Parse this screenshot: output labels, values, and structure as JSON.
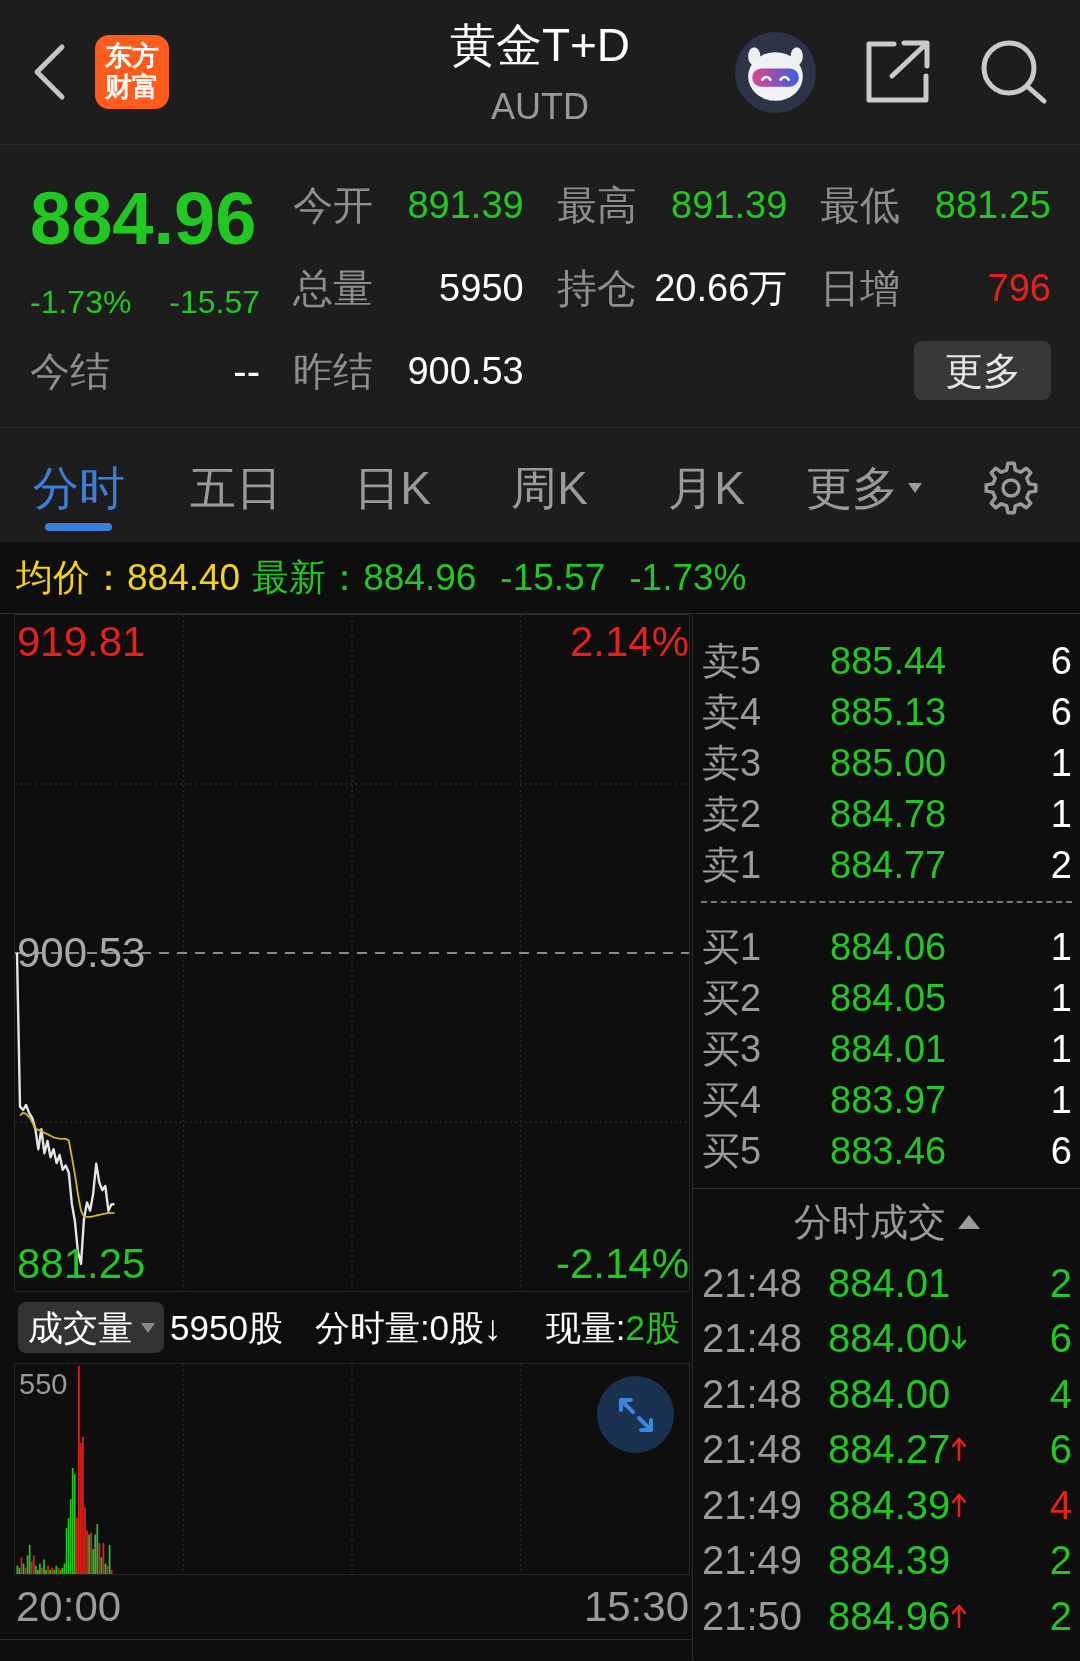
{
  "header": {
    "logo": {
      "lines": [
        "东方",
        "财富"
      ]
    },
    "title": "黄金T+D",
    "subtitle": "AUTD"
  },
  "quote": {
    "price": "884.96",
    "change_percent": "-1.73%",
    "change": "-15.57",
    "settle": {
      "label": "今结",
      "value": "--"
    },
    "stats": [
      {
        "label": "今开",
        "value": "891.39",
        "color": "#22c822"
      },
      {
        "label": "最高",
        "value": "891.39",
        "color": "#22c822"
      },
      {
        "label": "最低",
        "value": "881.25",
        "color": "#22c822"
      },
      {
        "label": "总量",
        "value": "5950",
        "color": "#ffffff"
      },
      {
        "label": "持仓",
        "value": "20.66万",
        "color": "#ffffff"
      },
      {
        "label": "日增",
        "value": "796",
        "color": "#e3221c"
      },
      {
        "label": "昨结",
        "value": "900.53",
        "color": "#ffffff"
      }
    ],
    "more_button": "更多"
  },
  "tabs": [
    {
      "label": "分时",
      "kind": "tab",
      "selected": true
    },
    {
      "label": "五日",
      "kind": "tab",
      "selected": false
    },
    {
      "label": "日K",
      "kind": "tab",
      "selected": false
    },
    {
      "label": "周K",
      "kind": "tab",
      "selected": false
    },
    {
      "label": "月K",
      "kind": "tab",
      "selected": false
    },
    {
      "label": "更多",
      "kind": "dropdown",
      "selected": false
    }
  ],
  "summary_line": {
    "average_label": "均价：",
    "average": "884.40",
    "latest_label": "最新：",
    "latest": "884.96",
    "change": "-15.57",
    "change_percent": "-1.73%"
  },
  "price_chart": {
    "chart_data": {
      "type": "line",
      "categories": [
        null,
        null,
        null,
        null,
        null,
        null,
        null,
        null,
        null,
        null,
        null,
        null,
        null,
        null,
        null,
        null,
        null,
        null,
        null,
        null,
        null,
        null,
        null,
        null,
        null,
        null,
        null,
        null,
        null,
        null,
        null,
        null,
        null,
        null,
        null,
        null,
        null,
        null,
        null,
        null,
        null,
        null,
        null,
        null,
        null,
        null,
        null,
        null,
        null,
        null,
        null,
        null,
        null,
        null,
        null,
        null,
        null,
        null,
        null,
        null,
        null,
        null,
        null,
        null,
        null,
        null,
        null,
        null,
        null,
        null,
        null,
        null,
        null,
        null,
        null,
        null,
        null,
        null,
        null,
        null,
        null,
        null,
        null,
        null,
        null,
        null,
        null,
        null,
        null,
        null,
        null,
        null,
        null,
        null,
        null,
        null,
        null,
        null,
        null,
        null,
        null,
        null,
        null,
        null,
        null,
        null,
        null,
        null,
        null,
        null,
        null,
        null,
        null,
        null,
        null,
        null,
        null,
        null,
        null,
        null,
        null,
        null,
        null,
        null,
        null,
        null,
        null,
        null,
        null,
        null,
        null,
        null,
        null,
        null,
        null,
        null,
        null,
        null,
        null,
        null,
        null,
        null,
        null,
        null,
        null,
        null,
        null,
        null,
        null,
        null,
        null,
        null,
        null,
        null,
        null,
        null,
        null,
        null,
        null,
        null,
        null,
        null,
        null,
        null,
        null,
        null,
        null,
        null,
        null,
        null,
        null,
        null,
        null,
        null,
        null,
        null,
        null,
        null,
        null,
        null,
        null,
        null,
        null,
        null,
        null,
        null,
        null,
        null,
        null,
        null,
        null,
        null,
        null,
        null,
        null,
        null,
        null,
        null,
        null,
        null,
        null,
        null,
        null,
        null,
        null,
        null,
        null,
        null,
        null,
        null,
        null,
        null,
        null,
        null,
        null,
        null,
        null,
        null,
        null,
        null,
        null
      ],
      "series": [
        {
          "color": "#e6e6e6",
          "values": [
            900.53,
            891.0,
            890.8,
            891.1,
            890.6,
            890.3,
            889.63,
            888.36,
            889.6,
            888.11,
            888.87,
            887.86,
            888.36,
            887.5,
            888.0,
            887.09,
            887.35,
            886.9,
            885.0,
            883.9,
            882.01,
            881.25,
            884.05,
            885.06,
            884.55,
            885.57,
            887.47,
            886.33,
            885.82,
            886.08,
            884.55,
            884.93,
            884.96,
            null,
            null,
            null,
            null,
            null,
            null,
            null,
            null,
            null,
            null,
            null,
            null,
            null,
            null,
            null,
            null,
            null,
            null,
            null,
            null,
            null,
            null,
            null,
            null,
            null,
            null,
            null,
            null,
            null,
            null,
            null,
            null,
            null,
            null,
            null,
            null,
            null,
            null,
            null,
            null,
            null,
            null,
            null,
            null,
            null,
            null,
            null,
            null,
            null,
            null,
            null,
            null,
            null,
            null,
            null,
            null,
            null,
            null,
            null,
            null,
            null,
            null,
            null,
            null,
            null,
            null,
            null,
            null,
            null,
            null,
            null,
            null,
            null,
            null,
            null,
            null,
            null,
            null,
            null,
            null,
            null,
            null,
            null,
            null,
            null,
            null,
            null,
            null,
            null,
            null,
            null,
            null,
            null,
            null,
            null,
            null,
            null,
            null,
            null,
            null,
            null,
            null,
            null,
            null,
            null,
            null,
            null,
            null,
            null,
            null,
            null,
            null,
            null,
            null,
            null,
            null,
            null,
            null,
            null,
            null,
            null,
            null,
            null,
            null,
            null,
            null,
            null,
            null,
            null,
            null,
            null,
            null,
            null,
            null,
            null,
            null,
            null,
            null,
            null,
            null,
            null,
            null,
            null,
            null,
            null,
            null,
            null,
            null,
            null,
            null,
            null,
            null,
            null,
            null,
            null,
            null,
            null,
            null,
            null,
            null,
            null,
            null,
            null,
            null,
            null,
            null,
            null,
            null,
            null,
            null,
            null,
            null,
            null,
            null,
            null,
            null,
            null,
            null,
            null,
            null,
            null,
            null,
            null,
            null,
            null,
            null,
            null,
            null
          ]
        },
        {
          "color": "#d6b62c",
          "values": [
            null,
            890.45,
            890.62,
            890.55,
            890.35,
            890.05,
            889.63,
            889.56,
            889.48,
            889.38,
            889.3,
            889.2,
            889.1,
            889.05,
            889.02,
            889.0,
            889.0,
            888.9,
            887.9,
            886.8,
            885.57,
            884.55,
            884.17,
            884.17,
            884.17,
            884.2,
            884.25,
            884.28,
            884.33,
            884.37,
            884.43,
            884.41,
            884.4,
            null,
            null,
            null,
            null,
            null,
            null,
            null,
            null,
            null,
            null,
            null,
            null,
            null,
            null,
            null,
            null,
            null,
            null,
            null,
            null,
            null,
            null,
            null,
            null,
            null,
            null,
            null,
            null,
            null,
            null,
            null,
            null,
            null,
            null,
            null,
            null,
            null,
            null,
            null,
            null,
            null,
            null,
            null,
            null,
            null,
            null,
            null,
            null,
            null,
            null,
            null,
            null,
            null,
            null,
            null,
            null,
            null,
            null,
            null,
            null,
            null,
            null,
            null,
            null,
            null,
            null,
            null,
            null,
            null,
            null,
            null,
            null,
            null,
            null,
            null,
            null,
            null,
            null,
            null,
            null,
            null,
            null,
            null,
            null,
            null,
            null,
            null,
            null,
            null,
            null,
            null,
            null,
            null,
            null,
            null,
            null,
            null,
            null,
            null,
            null,
            null,
            null,
            null,
            null,
            null,
            null,
            null,
            null,
            null,
            null,
            null,
            null,
            null,
            null,
            null,
            null,
            null,
            null,
            null,
            null,
            null,
            null,
            null,
            null,
            null,
            null,
            null,
            null,
            null,
            null,
            null,
            null,
            null,
            null,
            null,
            null,
            null,
            null,
            null,
            null,
            null,
            null,
            null,
            null,
            null,
            null,
            null,
            null,
            null,
            null,
            null,
            null,
            null,
            null,
            null,
            null,
            null,
            null,
            null,
            null,
            null,
            null,
            null,
            null,
            null,
            null,
            null,
            null,
            null,
            null,
            null,
            null,
            null,
            null,
            null,
            null,
            null,
            null,
            null,
            null,
            null,
            null,
            null,
            null,
            null,
            null,
            null,
            null
          ]
        }
      ],
      "ylim": [
        879.57,
        921.48
      ],
      "yticks": [
        {
          "value": 881.25,
          "label": "881.25"
        },
        {
          "value": 900.53,
          "label": "900.53"
        },
        {
          "value": 919.81,
          "label": "919.81"
        }
      ],
      "ref_lines": [
        {
          "axis": "y",
          "value": 900.53
        }
      ]
    },
    "percent_labels": [
      "2.14%",
      "-2.14%"
    ],
    "time_axis": [
      "20:00",
      "15:30"
    ]
  },
  "volume_header": {
    "selector": "成交量",
    "total": "5950股",
    "interval_volume": "分时量:0股↓",
    "current_label": "现量:",
    "current_value": "2股"
  },
  "volume_chart": {
    "max_label": "550"
  },
  "order_book": {
    "asks": [
      {
        "label": "卖5",
        "price": "885.44",
        "volume": "6"
      },
      {
        "label": "卖4",
        "price": "885.13",
        "volume": "6"
      },
      {
        "label": "卖3",
        "price": "885.00",
        "volume": "1"
      },
      {
        "label": "卖2",
        "price": "884.78",
        "volume": "1"
      },
      {
        "label": "卖1",
        "price": "884.77",
        "volume": "2"
      }
    ],
    "bids": [
      {
        "label": "买1",
        "price": "884.06",
        "volume": "1"
      },
      {
        "label": "买2",
        "price": "884.05",
        "volume": "1"
      },
      {
        "label": "买3",
        "price": "884.01",
        "volume": "1"
      },
      {
        "label": "买4",
        "price": "883.97",
        "volume": "1"
      },
      {
        "label": "买5",
        "price": "883.46",
        "volume": "6"
      }
    ]
  },
  "trades": {
    "title": "分时成交",
    "rows": [
      {
        "time": "21:48",
        "price": "884.01",
        "kind": "plain",
        "volume": "2",
        "color": "#22c822"
      },
      {
        "time": "21:48",
        "price": "884.00",
        "kind": "down",
        "volume": "6",
        "color": "#22c822"
      },
      {
        "time": "21:48",
        "price": "884.00",
        "kind": "plain",
        "volume": "4",
        "color": "#22c822"
      },
      {
        "time": "21:48",
        "price": "884.27",
        "kind": "up",
        "volume": "6",
        "color": "#22c822"
      },
      {
        "time": "21:49",
        "price": "884.39",
        "kind": "up",
        "volume": "4",
        "color": "#e3221c"
      },
      {
        "time": "21:49",
        "price": "884.39",
        "kind": "plain",
        "volume": "2",
        "color": "#22c822"
      },
      {
        "time": "21:50",
        "price": "884.96",
        "kind": "up",
        "volume": "2",
        "color": "#22c822"
      }
    ]
  }
}
